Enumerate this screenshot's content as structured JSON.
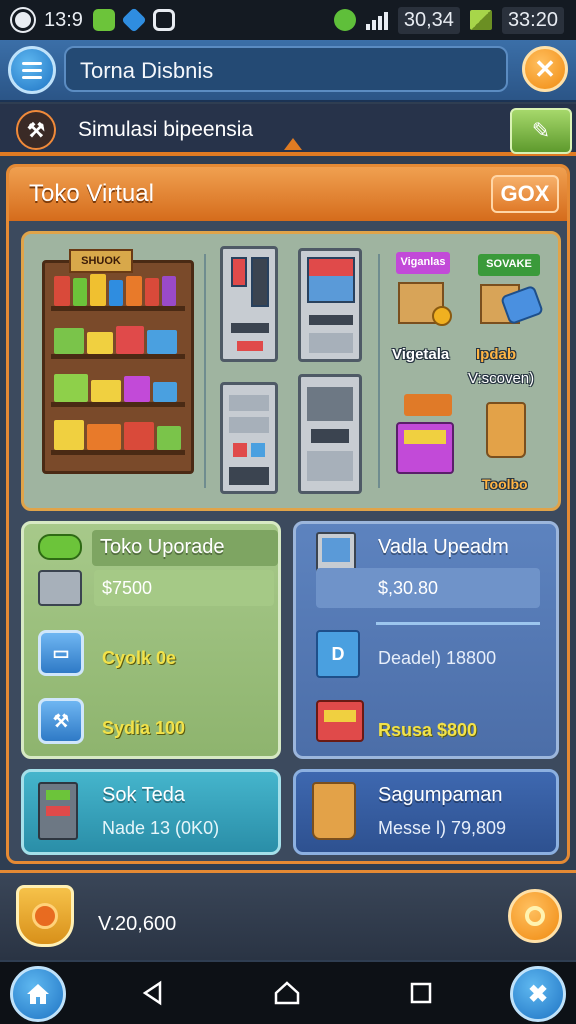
{
  "status_bar": {
    "time": "13:9",
    "signal_value": "30,34",
    "battery_value": "33:20",
    "icons": [
      "app-icon",
      "puzzle-icon",
      "gear-icon",
      "camera-icon",
      "leaf-icon",
      "signal-icon",
      "battery-icon"
    ],
    "colors": {
      "puzzle": "#6cc43a",
      "gear": "#2f8de0",
      "leaf": "#5fbf3a"
    }
  },
  "header": {
    "title_value": "Torna Disbnis",
    "menu_icon": "hamburger-icon",
    "close_icon": "close-icon"
  },
  "subheader": {
    "title": "Simulasi bipeensia",
    "logo_icon": "crossed-tools-icon",
    "action_icon": "ticket-icon"
  },
  "panel": {
    "title": "Toko Virtual",
    "button_label": "GOX",
    "accent_color": "#e58a34"
  },
  "store": {
    "shelf_sign": "SHUOK",
    "sign_vigetala": "Viganlas",
    "sign_sovake": "SOVAKE",
    "label_vigetala": "Vigetala",
    "label_ipdab": "Ipdab",
    "label_vscoven": "V:scoven)",
    "label_toolbo": "Toolbo"
  },
  "cards": {
    "toko_upgrade": {
      "title": "Toko Uporade",
      "price": "$7500",
      "item1": "Cyolk 0e",
      "item2": "Sydia 100",
      "item1_icon": "door-icon",
      "item2_icon": "hammer-icon"
    },
    "vadla_upgrade": {
      "title": "Vadla Upeadm",
      "price": "$,30.80",
      "item1": "Deadel) 18800",
      "item2": "Rsusa $800"
    },
    "sok_teda": {
      "title": "Sok Teda",
      "sub": "Nade 13 (0K0)"
    },
    "sagumpaman": {
      "title": "Sagumpaman",
      "sub": "Messe l) 79,809"
    }
  },
  "bottom": {
    "money": "V.20,600",
    "badge_icon": "target-badge-icon",
    "coin_icon": "coin-icon"
  },
  "navbar": {
    "home_icon": "home-icon",
    "back_icon": "back-triangle-icon",
    "home_sys_icon": "home-outline-icon",
    "recent_icon": "recent-square-icon",
    "tools_icon": "tools-icon"
  }
}
